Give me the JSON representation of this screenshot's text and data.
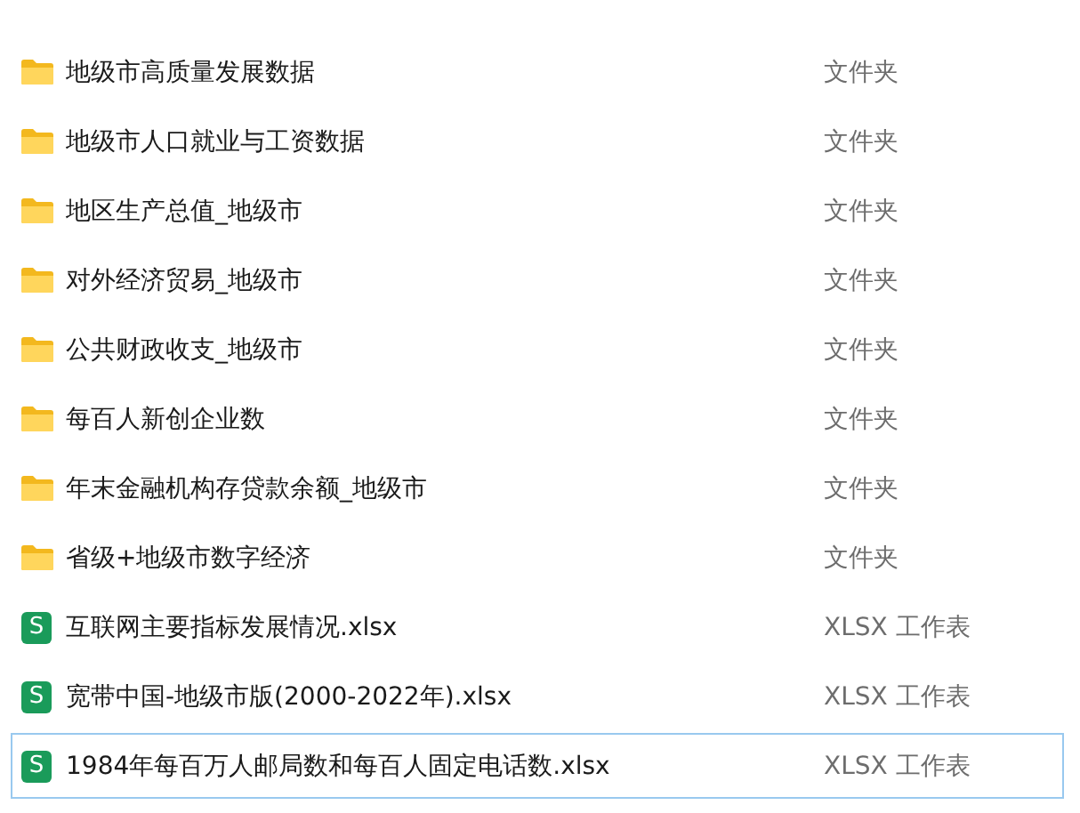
{
  "files": [
    {
      "kind": "folder",
      "name": "地级市高质量发展数据",
      "type": "文件夹",
      "selected": false
    },
    {
      "kind": "folder",
      "name": "地级市人口就业与工资数据",
      "type": "文件夹",
      "selected": false
    },
    {
      "kind": "folder",
      "name": "地区生产总值_地级市",
      "type": "文件夹",
      "selected": false
    },
    {
      "kind": "folder",
      "name": "对外经济贸易_地级市",
      "type": "文件夹",
      "selected": false
    },
    {
      "kind": "folder",
      "name": "公共财政收支_地级市",
      "type": "文件夹",
      "selected": false
    },
    {
      "kind": "folder",
      "name": "每百人新创企业数",
      "type": "文件夹",
      "selected": false
    },
    {
      "kind": "folder",
      "name": "年末金融机构存贷款余额_地级市",
      "type": "文件夹",
      "selected": false
    },
    {
      "kind": "folder",
      "name": "省级+地级市数字经济",
      "type": "文件夹",
      "selected": false
    },
    {
      "kind": "sheet",
      "icon_letter": "S",
      "name": "互联网主要指标发展情况.xlsx",
      "type": "XLSX 工作表",
      "selected": false
    },
    {
      "kind": "sheet",
      "icon_letter": "S",
      "name": "宽带中国-地级市版(2000-2022年).xlsx",
      "type": "XLSX 工作表",
      "selected": false
    },
    {
      "kind": "sheet",
      "icon_letter": "S",
      "name": "1984年每百万人邮局数和每百人固定电话数.xlsx",
      "type": "XLSX 工作表",
      "selected": true
    }
  ]
}
